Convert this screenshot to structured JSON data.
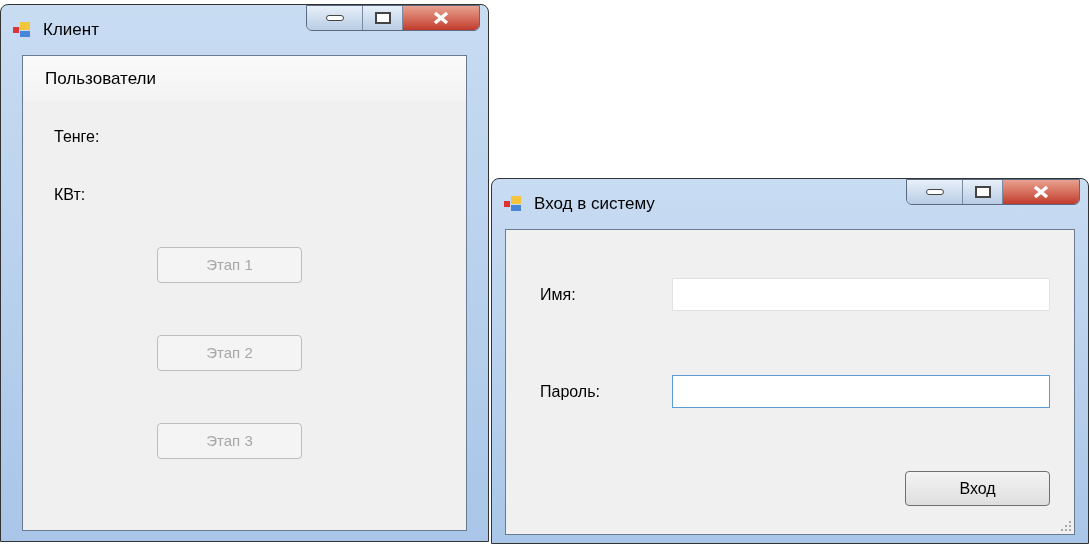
{
  "client_window": {
    "title": "Клиент",
    "menu": [
      {
        "label": "Пользователи"
      }
    ],
    "labels": [
      "Тенге:",
      "КВт:"
    ],
    "stage_buttons": [
      {
        "label": "Этап 1",
        "disabled": true
      },
      {
        "label": "Этап 2",
        "disabled": true
      },
      {
        "label": "Этап 3",
        "disabled": true
      }
    ]
  },
  "login_window": {
    "title": "Вход в систему",
    "fields": [
      {
        "label": "Имя:",
        "focused": false
      },
      {
        "label": "Пароль:",
        "focused": true
      }
    ],
    "button": "Вход"
  }
}
